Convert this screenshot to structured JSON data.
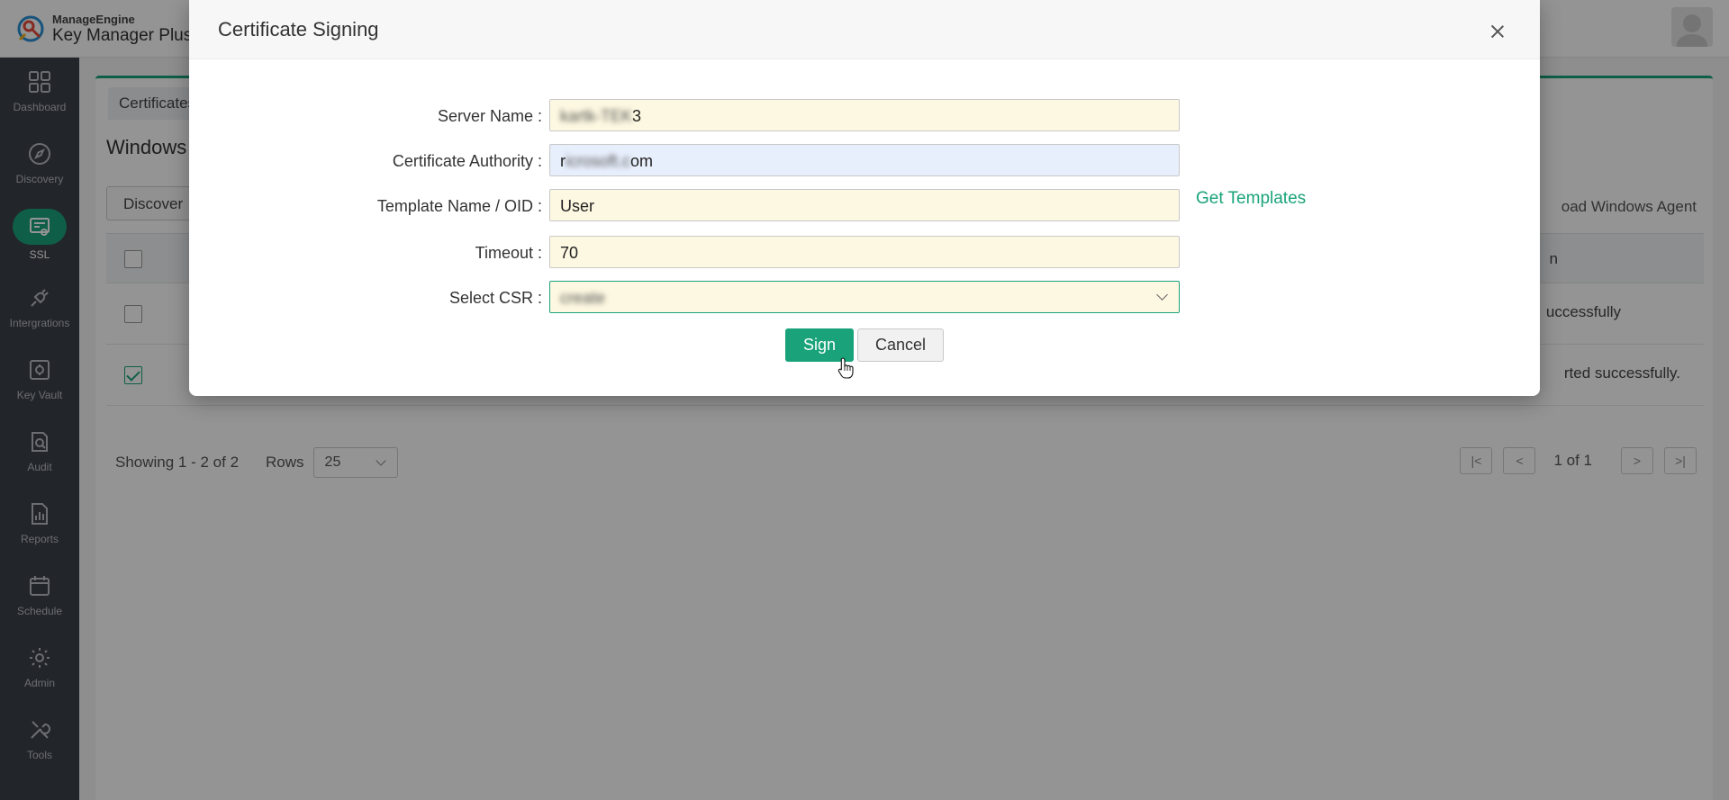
{
  "app": {
    "brand_small": "ManageEngine",
    "brand_big": "Key Manager Plus"
  },
  "sidebar": {
    "items": [
      {
        "label": "Dashboard",
        "icon": "dashboard-icon"
      },
      {
        "label": "Discovery",
        "icon": "compass-icon"
      },
      {
        "label": "SSL",
        "icon": "certificate-icon",
        "active": true
      },
      {
        "label": "Intergrations",
        "icon": "plug-icon"
      },
      {
        "label": "Key Vault",
        "icon": "vault-icon"
      },
      {
        "label": "Audit",
        "icon": "audit-icon"
      },
      {
        "label": "Reports",
        "icon": "reports-icon"
      },
      {
        "label": "Schedule",
        "icon": "calendar-icon"
      },
      {
        "label": "Admin",
        "icon": "gear-icon"
      },
      {
        "label": "Tools",
        "icon": "tools-icon"
      }
    ]
  },
  "background": {
    "tab_label": "Certificates",
    "section_title": "Windows",
    "discover_label": "Discover",
    "download_label": "oad Windows Agent",
    "status_header": "n",
    "rows": [
      {
        "status": "uccessfully",
        "checked": false
      },
      {
        "status": "rted successfully.",
        "checked": true
      }
    ],
    "showing": "Showing 1 - 2 of 2",
    "rows_label": "Rows",
    "rows_value": "25",
    "page_of": "1 of 1"
  },
  "modal": {
    "title": "Certificate Signing",
    "fields": {
      "server_name": {
        "label": "Server Name",
        "value": "3"
      },
      "cert_authority": {
        "label": "Certificate Authority",
        "value": "r        om"
      },
      "template_name": {
        "label": "Template Name / OID",
        "value": "User"
      },
      "timeout": {
        "label": "Timeout",
        "value": "70"
      },
      "select_csr": {
        "label": "Select CSR",
        "value": ""
      }
    },
    "get_templates": "Get Templates",
    "sign_label": "Sign",
    "cancel_label": "Cancel"
  },
  "colors": {
    "accent": "#1aa37a",
    "field_bg": "#fdf8e1",
    "field_autofill_bg": "#e8effc",
    "sidebar_bg": "#3b4049"
  }
}
